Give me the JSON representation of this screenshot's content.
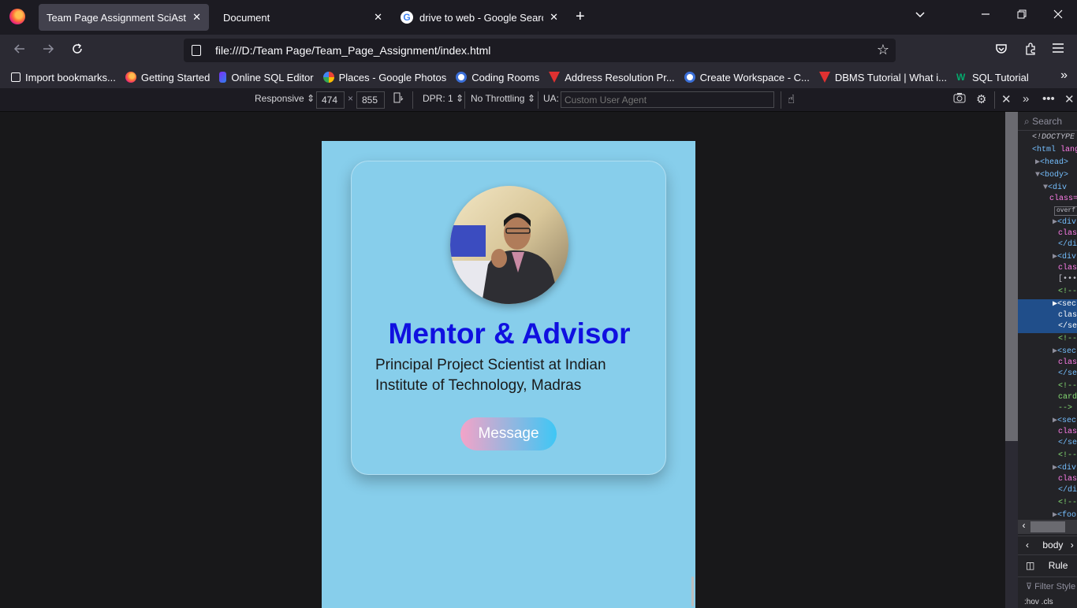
{
  "tabs": [
    {
      "title": "Team Page Assignment SciAstra Edu",
      "active": true
    },
    {
      "title": "Document",
      "active": false
    },
    {
      "title": "drive to web - Google Search",
      "active": false
    }
  ],
  "url": "file:///D:/Team Page/Team_Page_Assignment/index.html",
  "bookmarks": [
    {
      "label": "Import bookmarks...",
      "icon": "import-icon"
    },
    {
      "label": "Getting Started",
      "icon": "firefox-icon"
    },
    {
      "label": "Online SQL Editor",
      "icon": "sql-editor-icon"
    },
    {
      "label": "Places - Google Photos",
      "icon": "google-photos-icon"
    },
    {
      "label": "Coding Rooms",
      "icon": "coding-rooms-icon"
    },
    {
      "label": "Address Resolution Pr...",
      "icon": "tutorial-icon"
    },
    {
      "label": "Create Workspace - C...",
      "icon": "coding-rooms-icon"
    },
    {
      "label": "DBMS Tutorial | What i...",
      "icon": "tutorial-icon"
    },
    {
      "label": "SQL Tutorial",
      "icon": "w3schools-icon"
    }
  ],
  "rdm": {
    "device": "Responsive",
    "width": "474",
    "height": "855",
    "dpr": "DPR: 1",
    "throttling": "No Throttling",
    "ua_label": "UA:",
    "ua_placeholder": "Custom User Agent"
  },
  "card": {
    "title": "Mentor & Advisor",
    "description": "Principal Project Scientist at Indian Institute of Technology, Madras",
    "button": "Message"
  },
  "devtools": {
    "search_placeholder": "Search",
    "breadcrumb": "body",
    "rules_tab": "Rule",
    "filter_placeholder": "Filter Style",
    "hov": ":hov  .cls"
  }
}
